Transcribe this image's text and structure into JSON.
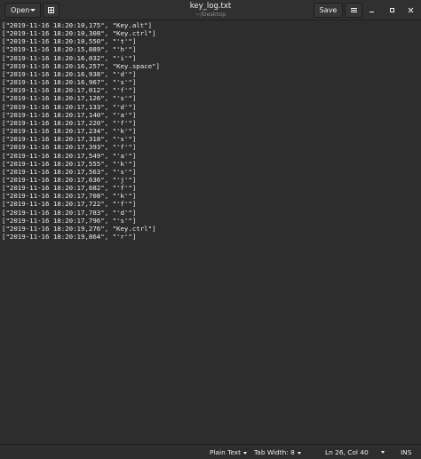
{
  "header": {
    "open_label": "Open",
    "title": "key_log.txt",
    "subtitle": "~/Desktop",
    "save_label": "Save"
  },
  "document": {
    "lines": [
      "[\"2019-11-16 18:20:10,175\", \"Key.alt\"]",
      "[\"2019-11-16 18:20:10,308\", \"Key.ctrl\"]",
      "[\"2019-11-16 18:20:10,550\", \"'t'\"]",
      "[\"2019-11-16 18:20:15,889\", \"'h'\"]",
      "[\"2019-11-16 18:20:16,032\", \"'i'\"]",
      "[\"2019-11-16 18:20:16,257\", \"Key.space\"]",
      "[\"2019-11-16 18:20:16,938\", \"'d'\"]",
      "[\"2019-11-16 18:20:16,967\", \"'s'\"]",
      "[\"2019-11-16 18:20:17,012\", \"'f'\"]",
      "[\"2019-11-16 18:20:17,126\", \"'s'\"]",
      "[\"2019-11-16 18:20:17,133\", \"'d'\"]",
      "[\"2019-11-16 18:20:17,140\", \"'a'\"]",
      "[\"2019-11-16 18:20:17,220\", \"'f'\"]",
      "[\"2019-11-16 18:20:17,234\", \"'k'\"]",
      "[\"2019-11-16 18:20:17,318\", \"'s'\"]",
      "[\"2019-11-16 18:20:17,393\", \"'f'\"]",
      "[\"2019-11-16 18:20:17,549\", \"'a'\"]",
      "[\"2019-11-16 18:20:17,555\", \"'k'\"]",
      "[\"2019-11-16 18:20:17,563\", \"'s'\"]",
      "[\"2019-11-16 18:20:17,636\", \"'j'\"]",
      "[\"2019-11-16 18:20:17,682\", \"'f'\"]",
      "[\"2019-11-16 18:20:17,708\", \"'k'\"]",
      "[\"2019-11-16 18:20:17,722\", \"'f'\"]",
      "[\"2019-11-16 18:20:17,783\", \"'d'\"]",
      "[\"2019-11-16 18:20:17,796\", \"'s'\"]",
      "[\"2019-11-16 18:20:19,276\", \"Key.ctrl\"]",
      "[\"2019-11-16 18:20:19,864\", \"'r'\"]"
    ]
  },
  "statusbar": {
    "language": "Plain Text",
    "tab_width": "Tab Width: 8",
    "position": "Ln 26, Col 40",
    "mode": "INS"
  },
  "icons": {
    "open_dropdown": "chevron-down-icon",
    "new_tab": "new-document-icon",
    "menu": "hamburger-menu-icon",
    "minimize": "minimize-icon",
    "maximize": "maximize-icon",
    "close": "close-icon"
  },
  "colors": {
    "background": "#2d2d2d",
    "headerbar": "#303030",
    "text": "#eeeeec"
  }
}
